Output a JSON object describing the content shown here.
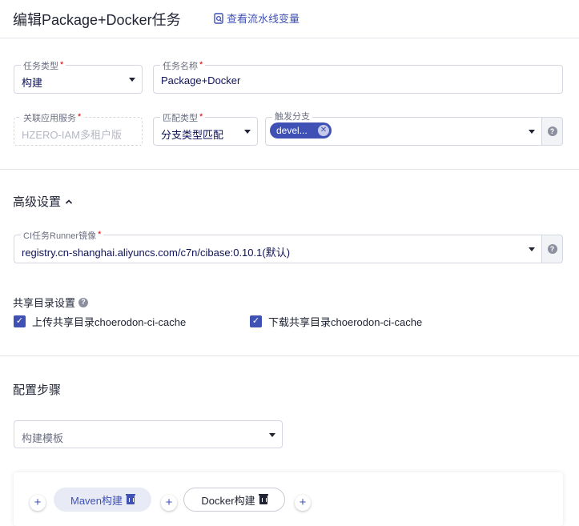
{
  "header": {
    "title": "编辑Package+Docker任务",
    "view_vars_label": "查看流水线变量"
  },
  "form": {
    "task_type": {
      "label": "任务类型",
      "value": "构建"
    },
    "task_name": {
      "label": "任务名称",
      "value": "Package+Docker"
    },
    "app_service": {
      "label": "关联应用服务",
      "value": "HZERO-IAM多租户版"
    },
    "match_type": {
      "label": "匹配类型",
      "value": "分支类型匹配"
    },
    "trigger_branch": {
      "label": "触发分支",
      "tag": "devel..."
    }
  },
  "advanced": {
    "title": "高级设置",
    "runner_image": {
      "label": "CI任务Runner镜像",
      "value": "registry.cn-shanghai.aliyuncs.com/c7n/cibase:0.10.1(默认)"
    },
    "shared_dir_title": "共享目录设置",
    "upload_label": "上传共享目录choerodon-ci-cache",
    "download_label": "下载共享目录choerodon-ci-cache"
  },
  "steps": {
    "title": "配置步骤",
    "template_placeholder": "构建模板",
    "items": [
      {
        "label": "Maven构建"
      },
      {
        "label": "Docker构建"
      }
    ]
  },
  "icons": {
    "required_mark": "*",
    "help": "?",
    "check": "✓",
    "close": "✕",
    "plus": "+",
    "chevron_up": "^"
  },
  "colors": {
    "primary": "#3f51b5",
    "required": "#d50000",
    "step_active_bg": "#e8eaf6"
  }
}
